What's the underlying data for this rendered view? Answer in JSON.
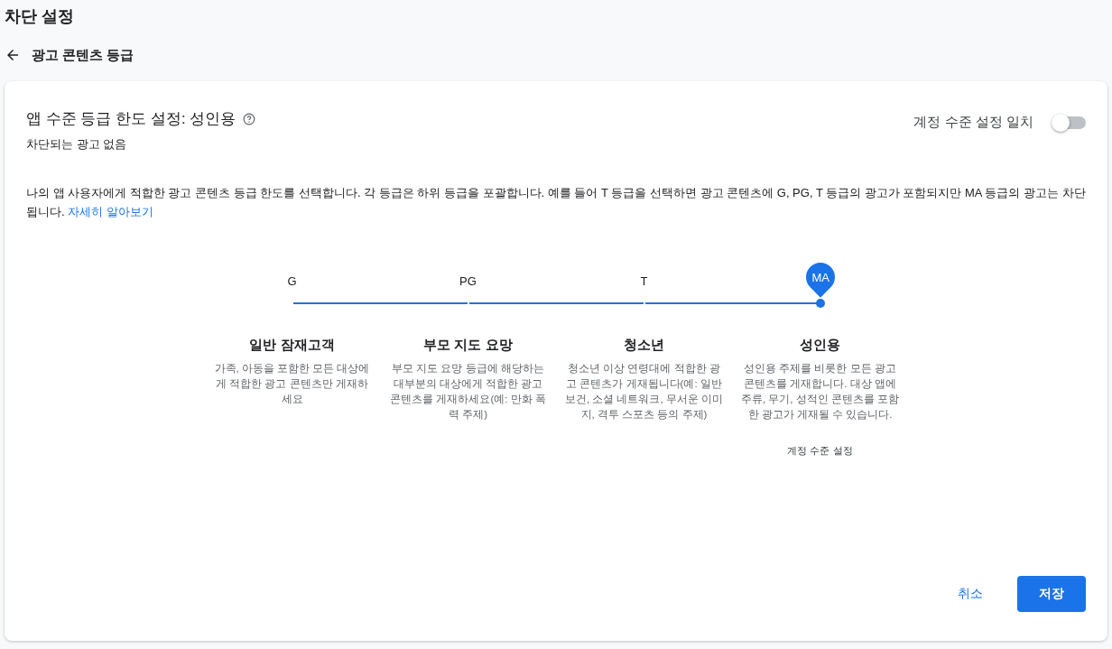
{
  "page_title": "차단 설정",
  "back_row": {
    "title": "광고 콘텐츠 등급"
  },
  "card": {
    "heading": "앱 수준 등급 한도 설정: 성인용",
    "subheading": "차단되는 광고 없음",
    "toggle": {
      "label": "계정 수준 설정 일치",
      "on": false
    },
    "description": "나의 앱 사용자에게 적합한 광고 콘텐츠 등급 한도를 선택합니다. 각 등급은 하위 등급을 포괄합니다. 예를 들어 T 등급을 선택하면 광고 콘텐츠에 G, PG, T 등급의 광고가 포함되지만 MA 등급의 광고는 차단됩니다.",
    "learn_more": "자세히 알아보기",
    "tiers": [
      {
        "code": "G",
        "title": "일반 잠재고객",
        "text": "가족, 아동을 포함한 모든 대상에게 적합한 광고 콘텐츠만 게재하세요",
        "selected": false
      },
      {
        "code": "PG",
        "title": "부모 지도 요망",
        "text": "부모 지도 요망 등급에 해당하는 대부분의 대상에게 적합한 광고 콘텐츠를 게재하세요(예: 만화 폭력 주제)",
        "selected": false
      },
      {
        "code": "T",
        "title": "청소년",
        "text": "청소년 이상 연령대에 적합한 광고 콘텐츠가 게재됩니다(예: 일반 보건, 소셜 네트워크, 무서운 이미지, 격투 스포츠 등의 주제)",
        "selected": false
      },
      {
        "code": "MA",
        "title": "성인용",
        "text": "성인용 주제를 비롯한 모든 광고 콘텐츠를 게재합니다. 대상 앱에 주류, 무기, 성적인 콘텐츠를 포함한 광고가 게재될 수 있습니다.",
        "selected": true,
        "note": "계정 수준 설정"
      }
    ],
    "buttons": {
      "cancel": "취소",
      "save": "저장"
    }
  }
}
